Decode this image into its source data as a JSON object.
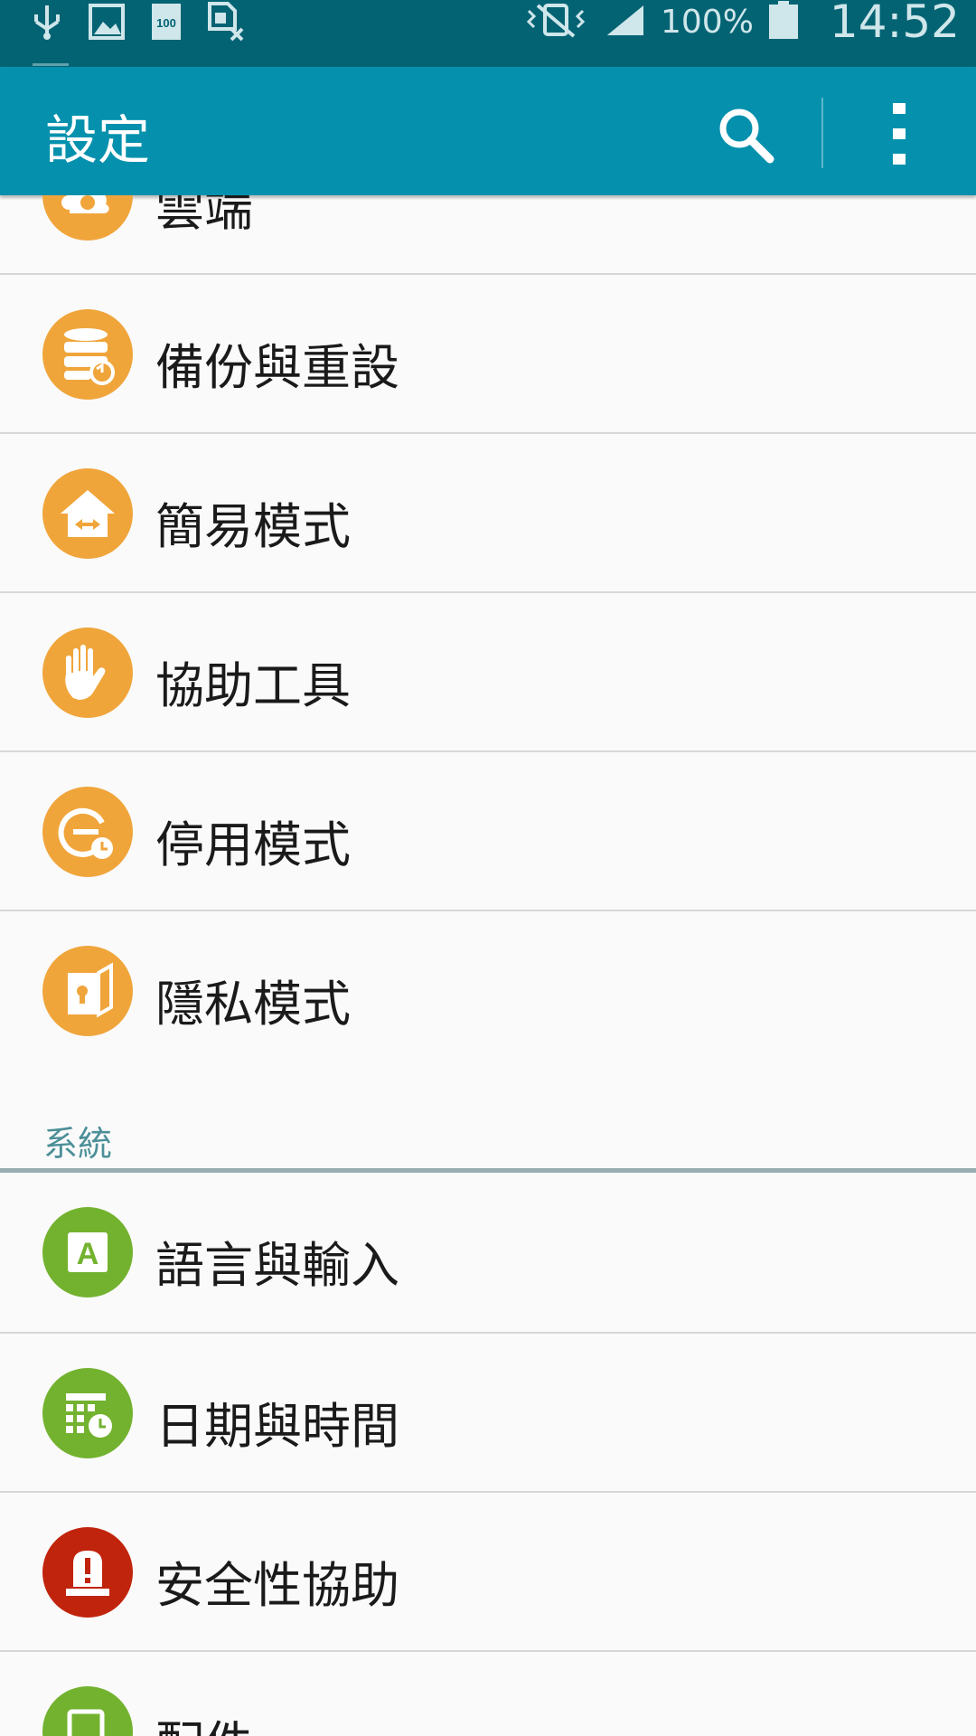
{
  "status_bar": {
    "battery_percent": "100%",
    "time": "14:52",
    "left_icons": [
      "usb-icon",
      "image-icon",
      "storage-100-icon",
      "sim-off-icon"
    ],
    "right_icons": [
      "mute-vibrate-icon",
      "signal-icon",
      "battery-icon"
    ]
  },
  "app_bar": {
    "title": "設定",
    "search_icon": "search-icon",
    "more_icon": "more-vert-icon"
  },
  "colors": {
    "status_bar": "#036373",
    "app_bar": "#0591ad",
    "orange_icon": "#f0a53b",
    "green_icon": "#73b22f",
    "red_icon": "#c1240c",
    "section_header": "#4c8f98"
  },
  "settings": {
    "partial_top": {
      "label": "雲端",
      "icon": "cloud-icon"
    },
    "items": [
      {
        "label": "備份與重設",
        "icon": "backup-reset-icon"
      },
      {
        "label": "簡易模式",
        "icon": "easy-mode-icon"
      },
      {
        "label": "協助工具",
        "icon": "accessibility-hand-icon"
      },
      {
        "label": "停用模式",
        "icon": "blocking-mode-icon"
      },
      {
        "label": "隱私模式",
        "icon": "private-mode-icon"
      }
    ],
    "system_section": {
      "header": "系統",
      "items": [
        {
          "label": "語言與輸入",
          "icon": "language-input-icon"
        },
        {
          "label": "日期與時間",
          "icon": "date-time-icon"
        },
        {
          "label": "安全性協助",
          "icon": "safety-assistance-icon"
        },
        {
          "label": "配件",
          "icon": "accessories-icon"
        }
      ]
    }
  }
}
